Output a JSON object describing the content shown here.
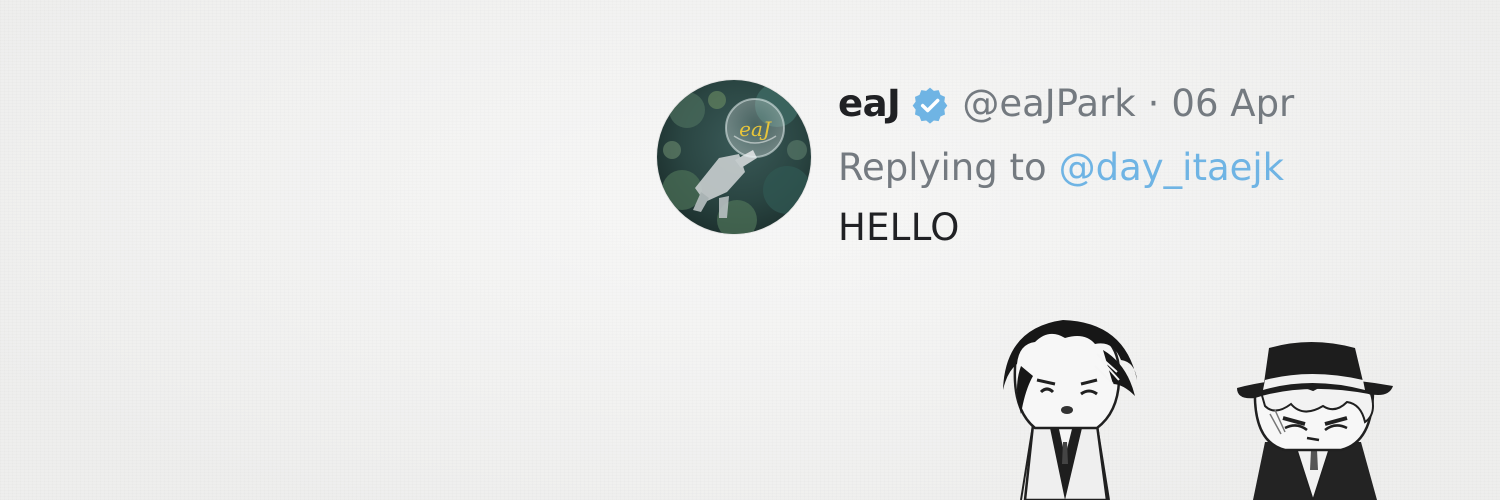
{
  "tweet": {
    "display_name": "eaJ",
    "handle": "@eaJPark",
    "separator": "·",
    "date": "06 Apr",
    "replying_to_label": "Replying to",
    "replying_to_handle": "@day_itaejk",
    "text": "HELLO",
    "avatar_lettering": "eaJ"
  },
  "colors": {
    "background": "#f3f3f2",
    "name": "#202124",
    "muted": "#747a80",
    "link": "#6fb4e4",
    "verified_badge": "#6fb4e4"
  },
  "icons": {
    "verified": "verified-badge-icon"
  }
}
